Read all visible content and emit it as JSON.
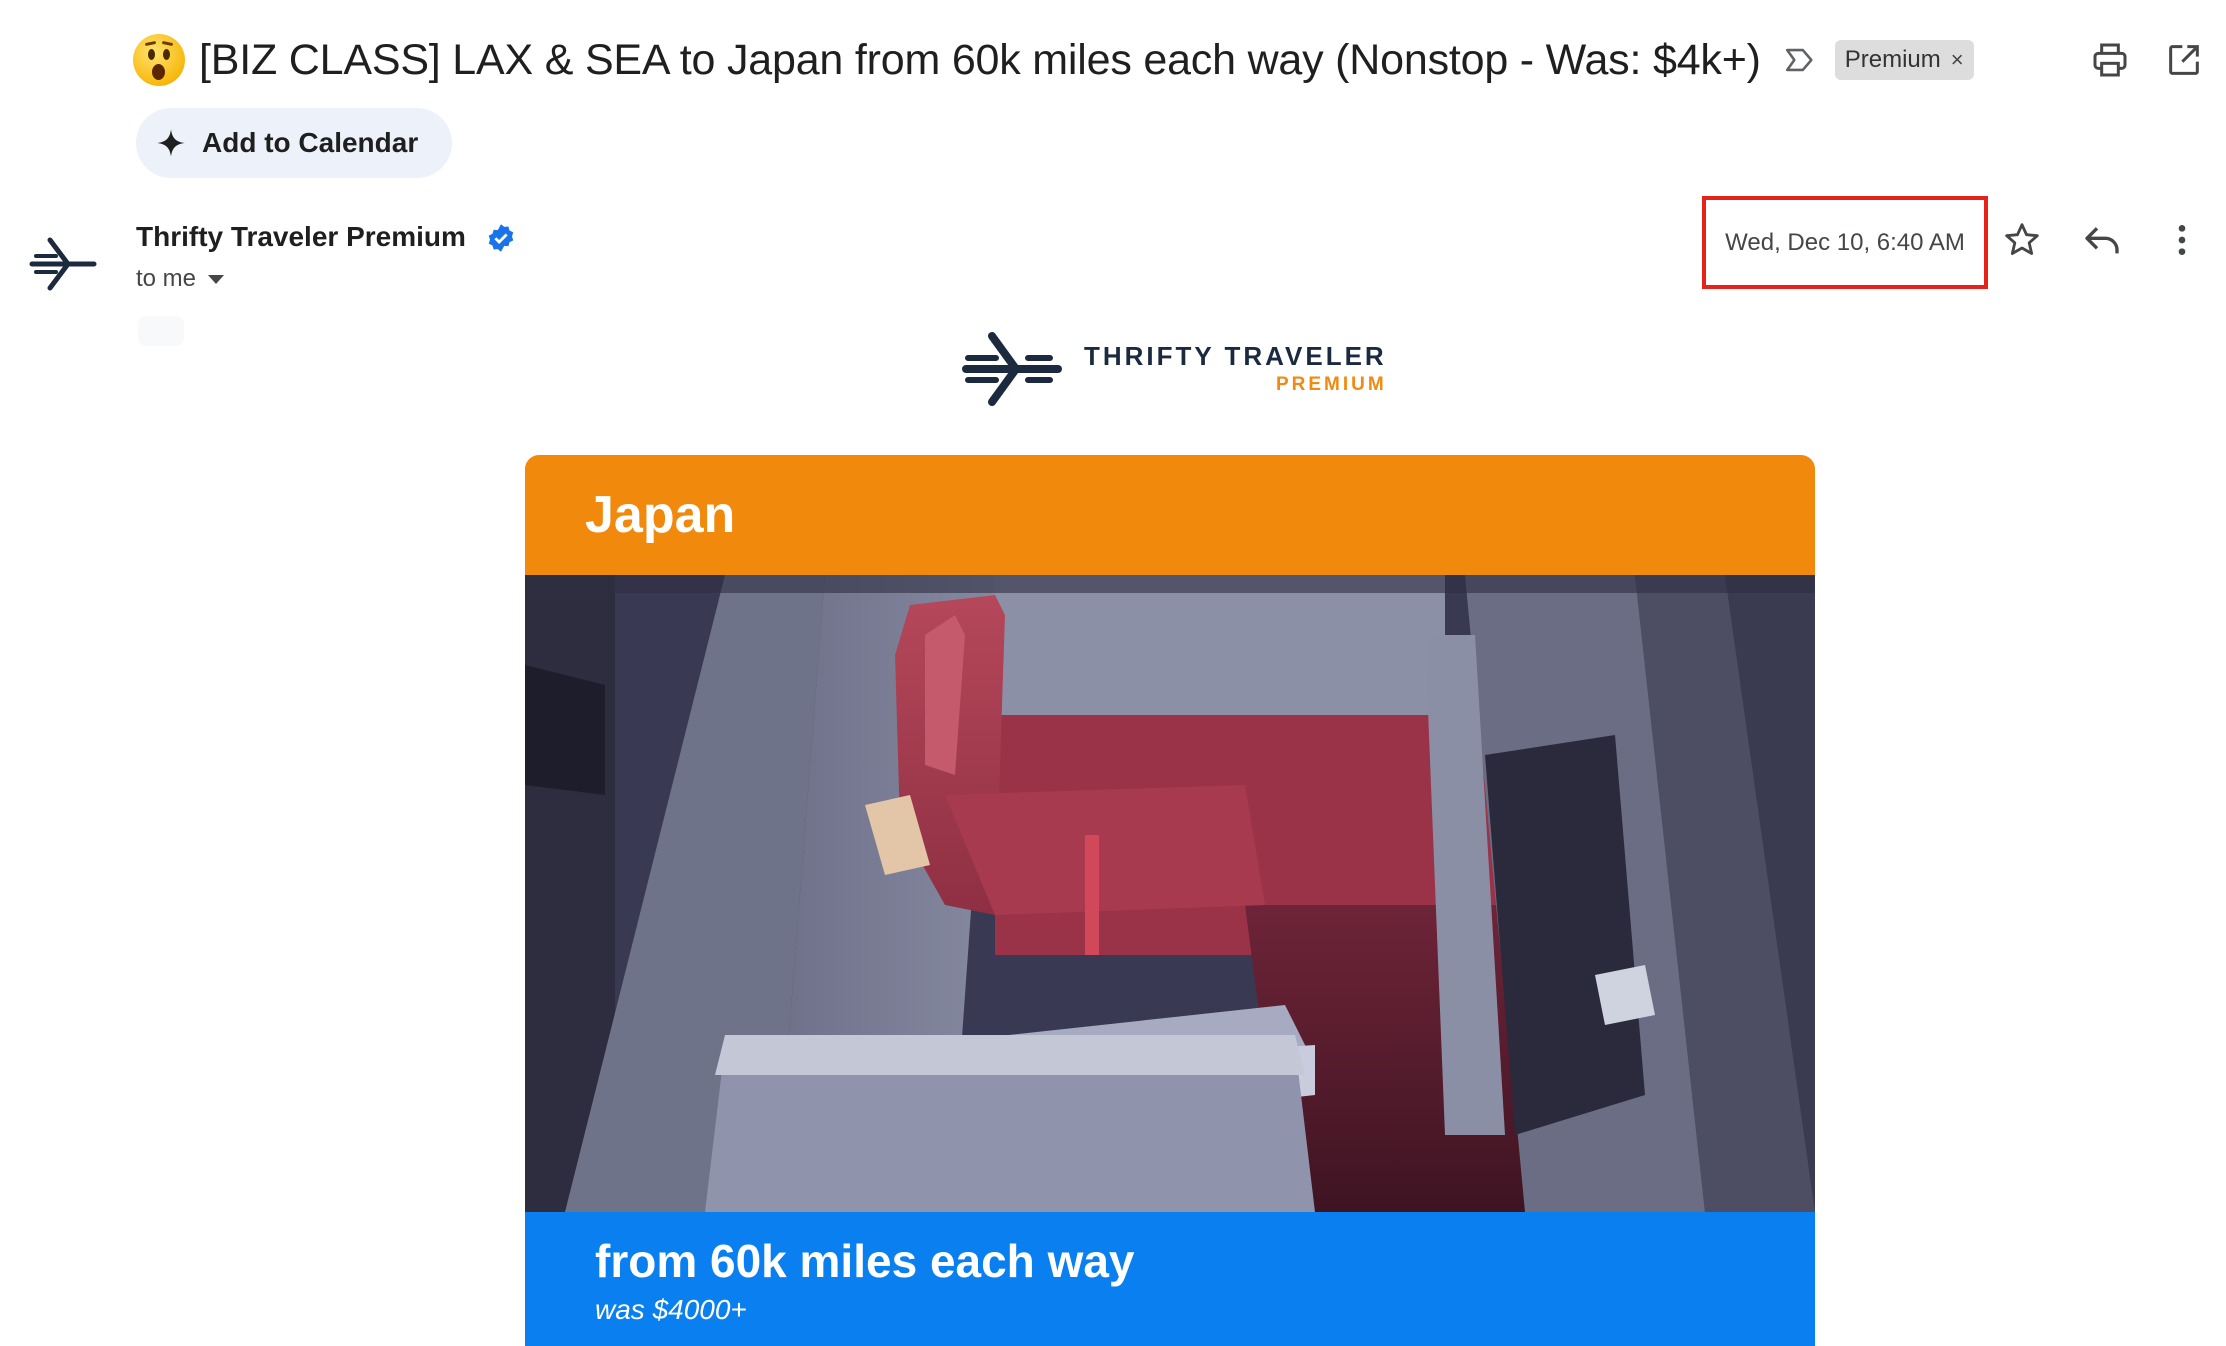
{
  "email": {
    "subject": "[BIZ CLASS] LAX & SEA to Japan from 60k miles each way (Nonstop - Was: $4k+)",
    "subject_emoji": "astonished-face",
    "label": "Premium",
    "label_remove": "×",
    "add_to_calendar": "Add to Calendar",
    "sender_name": "Thrifty Traveler Premium",
    "recipient": "to me",
    "date": "Wed, Dec 10, 6:40 AM"
  },
  "icons": {
    "important": "important-marker-icon",
    "print": "print-icon",
    "new_window": "open-in-new-window-icon",
    "sparkle": "sparkle-icon",
    "verified": "verified-badge-icon",
    "star": "star-icon",
    "reply": "reply-icon",
    "more": "more-vert-icon"
  },
  "brand": {
    "name": "THRIFTY TRAVELER",
    "sub": "PREMIUM"
  },
  "deal": {
    "destination": "Japan",
    "price": "from 60k miles each way",
    "was": "was $4000+"
  },
  "colors": {
    "header_orange": "#f0890c",
    "footer_blue": "#0a7ff0",
    "highlight_red": "#e5231a",
    "brand_navy": "#1c2a3f"
  }
}
